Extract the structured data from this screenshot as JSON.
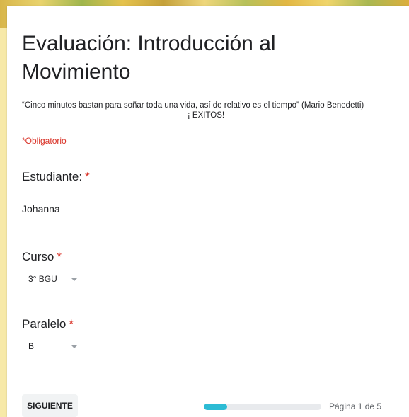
{
  "form": {
    "title": "Evaluación: Introducción al Movimiento",
    "quote_line1": "“Cinco minutos bastan para soñar toda una vida,  así de relativo es el tiempo”  (Mario Benedetti)",
    "quote_line2": "¡ EXITOS!",
    "required_note": "*Obligatorio",
    "accent_color": "#2cbbd4",
    "required_color": "#d93025"
  },
  "questions": {
    "student": {
      "label": "Estudiante:",
      "star": "*",
      "value": "Johanna"
    },
    "course": {
      "label": "Curso",
      "star": "*",
      "selected": "3° BGU"
    },
    "section": {
      "label": "Paralelo",
      "star": "*",
      "selected": "B"
    }
  },
  "footer": {
    "next_label": "SIGUIENTE",
    "page_label": "Página 1 de 5",
    "progress": 0.2
  }
}
